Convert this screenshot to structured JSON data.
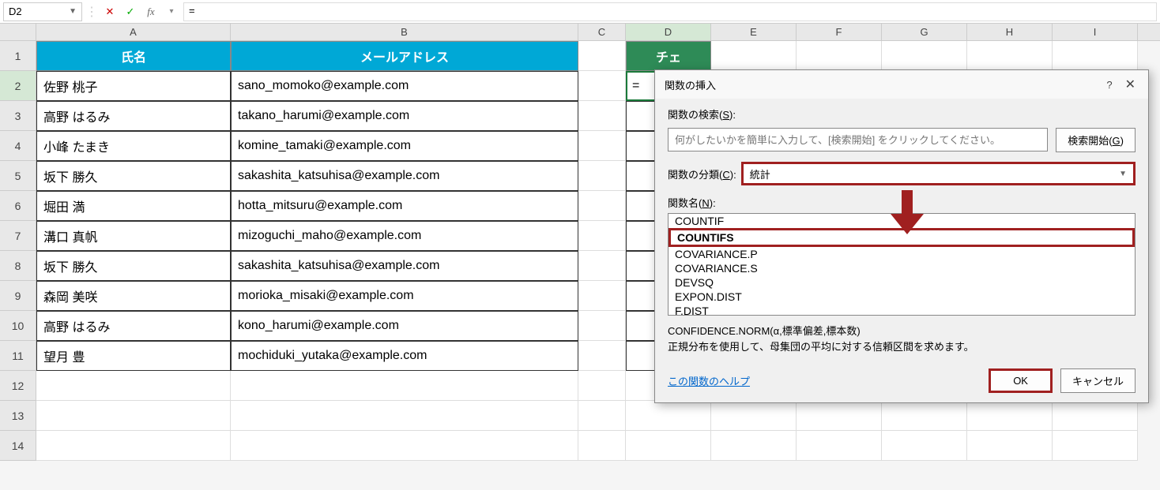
{
  "formula_bar": {
    "name_box": "D2",
    "formula": "="
  },
  "columns": [
    "A",
    "B",
    "C",
    "D",
    "E",
    "F",
    "G",
    "H",
    "I"
  ],
  "active_column": "D",
  "active_row": 2,
  "row_count": 14,
  "headers": {
    "A": "氏名",
    "B": "メールアドレス",
    "D": "チェ"
  },
  "table": [
    {
      "name": "佐野 桃子",
      "email": "sano_momoko@example.com"
    },
    {
      "name": "高野 はるみ",
      "email": "takano_harumi@example.com"
    },
    {
      "name": "小峰 たまき",
      "email": "komine_tamaki@example.com"
    },
    {
      "name": "坂下 勝久",
      "email": "sakashita_katsuhisa@example.com"
    },
    {
      "name": "堀田 満",
      "email": "hotta_mitsuru@example.com"
    },
    {
      "name": "溝口 真帆",
      "email": "mizoguchi_maho@example.com"
    },
    {
      "name": "坂下 勝久",
      "email": "sakashita_katsuhisa@example.com"
    },
    {
      "name": "森岡 美咲",
      "email": "morioka_misaki@example.com"
    },
    {
      "name": "高野 はるみ",
      "email": "kono_harumi@example.com"
    },
    {
      "name": "望月 豊",
      "email": "mochiduki_yutaka@example.com"
    }
  ],
  "d2_value": "=",
  "dialog": {
    "title": "関数の挿入",
    "search_label": "関数の検索(S):",
    "search_placeholder": "何がしたいかを簡単に入力して、[検索開始] をクリックしてください。",
    "search_button": "検索開始(G)",
    "category_label": "関数の分類(C):",
    "category_value": "統計",
    "list_label": "関数名(N):",
    "functions": [
      "COUNTIF",
      "COUNTIFS",
      "COVARIANCE.P",
      "COVARIANCE.S",
      "DEVSQ",
      "EXPON.DIST",
      "F.DIST"
    ],
    "selected_function": "COUNTIFS",
    "desc_syntax": "CONFIDENCE.NORM(α,標準偏差,標本数)",
    "desc_text": "正規分布を使用して、母集団の平均に対する信頼区間を求めます。",
    "help_link": "この関数のヘルプ",
    "ok": "OK",
    "cancel": "キャンセル"
  }
}
